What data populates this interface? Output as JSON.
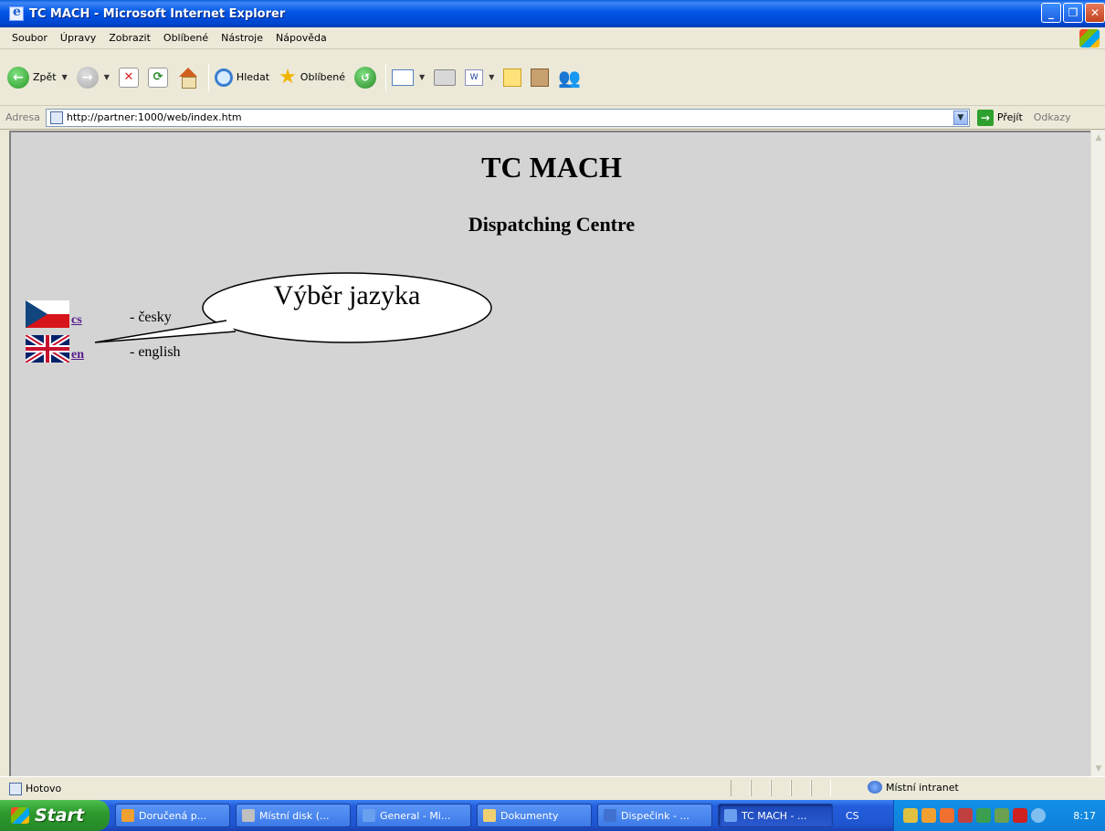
{
  "window": {
    "title": "TC MACH - Microsoft Internet Explorer"
  },
  "menu": [
    "Soubor",
    "Úpravy",
    "Zobrazit",
    "Oblíbené",
    "Nástroje",
    "Nápověda"
  ],
  "toolbar": {
    "back_label": "Zpět",
    "search_label": "Hledat",
    "favorites_label": "Oblíbené"
  },
  "address": {
    "label": "Adresa",
    "url": "http://partner:1000/web/index.htm",
    "go_label": "Přejít",
    "links_label": "Odkazy"
  },
  "page": {
    "title": "TC MACH",
    "subtitle": "Dispatching Centre",
    "languages": [
      {
        "code": "cs",
        "description": "- česky",
        "flag": "flag-cz-icon"
      },
      {
        "code": "en",
        "description": "- english",
        "flag": "flag-uk-icon"
      }
    ],
    "callout": "Výběr jazyka"
  },
  "status": {
    "text": "Hotovo",
    "zone": "Místní intranet"
  },
  "taskbar": {
    "start_label": "Start",
    "tasks": [
      {
        "label": "Doručená p...",
        "color": "#f0a030"
      },
      {
        "label": "Místní disk (...",
        "color": "#c0c0c0"
      },
      {
        "label": "General - Mi...",
        "color": "#6aa0f0"
      },
      {
        "label": "Dokumenty",
        "color": "#f0d070"
      },
      {
        "label": "Dispečink - ...",
        "color": "#4070d0"
      },
      {
        "label": "TC MACH - ...",
        "color": "#6aa0f0"
      }
    ],
    "input_language": "CS",
    "clock": "8:17"
  },
  "colors": {
    "content_bg": "#d4d4d4",
    "link": "#551a8b",
    "titlebar": "#0055e5"
  }
}
